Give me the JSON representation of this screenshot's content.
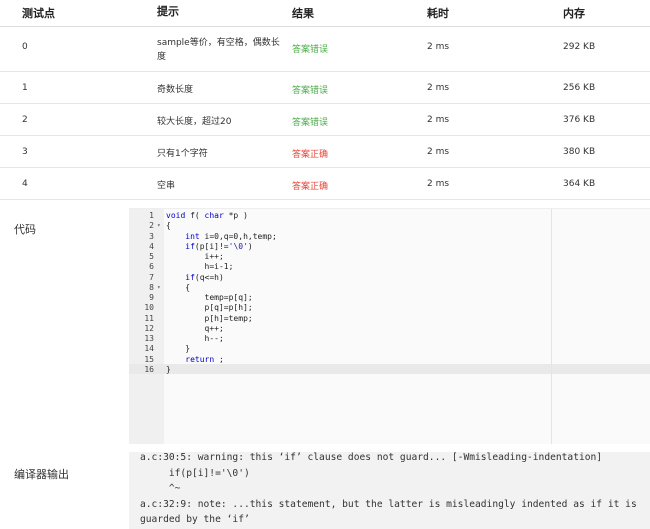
{
  "table": {
    "headers": [
      "测试点",
      "提示",
      "结果",
      "耗时",
      "内存"
    ],
    "rows": [
      {
        "id": "0",
        "hint": "sample等价，有空格，偶数长度",
        "result": "答案错误",
        "time": "2 ms",
        "memory": "292 KB",
        "status": "wrong"
      },
      {
        "id": "1",
        "hint": "奇数长度",
        "result": "答案错误",
        "time": "2 ms",
        "memory": "256 KB",
        "status": "wrong"
      },
      {
        "id": "2",
        "hint": "较大长度，超过20",
        "result": "答案错误",
        "time": "2 ms",
        "memory": "376 KB",
        "status": "wrong"
      },
      {
        "id": "3",
        "hint": "只有1个字符",
        "result": "答案正确",
        "time": "2 ms",
        "memory": "380 KB",
        "status": "correct"
      },
      {
        "id": "4",
        "hint": "空串",
        "result": "答案正确",
        "time": "2 ms",
        "memory": "364 KB",
        "status": "correct"
      }
    ]
  },
  "colors": {
    "wrong": "#4cae4c",
    "correct": "#e9433a"
  },
  "code_section": {
    "label": "代码",
    "lines": [
      {
        "n": "1",
        "fold": "",
        "text": "void f( char *p )"
      },
      {
        "n": "2",
        "fold": "▾",
        "text": "{"
      },
      {
        "n": "3",
        "fold": "",
        "text": "    int i=0,q=0,h,temp;"
      },
      {
        "n": "4",
        "fold": "",
        "text": "    if(p[i]!='\\0')"
      },
      {
        "n": "5",
        "fold": "",
        "text": "        i++;"
      },
      {
        "n": "6",
        "fold": "",
        "text": "        h=i-1;"
      },
      {
        "n": "7",
        "fold": "",
        "text": "    if(q<=h)"
      },
      {
        "n": "8",
        "fold": "▾",
        "text": "    {"
      },
      {
        "n": "9",
        "fold": "",
        "text": "        temp=p[q];"
      },
      {
        "n": "10",
        "fold": "",
        "text": "        p[q]=p[h];"
      },
      {
        "n": "11",
        "fold": "",
        "text": "        p[h]=temp;"
      },
      {
        "n": "12",
        "fold": "",
        "text": "        q++;"
      },
      {
        "n": "13",
        "fold": "",
        "text": "        h--;"
      },
      {
        "n": "14",
        "fold": "",
        "text": "    }"
      },
      {
        "n": "15",
        "fold": "",
        "text": "    return ;"
      },
      {
        "n": "16",
        "fold": "",
        "text": "}"
      }
    ]
  },
  "compiler_section": {
    "label": "编译器输出",
    "lines": [
      "a.c:30:5: warning: this ‘if’ clause does not guard... [-Wmisleading-indentation]",
      "     if(p[i]!='\\0')",
      "     ^~",
      "a.c:32:9: note: ...this statement, but the latter is misleadingly indented as if it is",
      "guarded by the ‘if’"
    ]
  }
}
